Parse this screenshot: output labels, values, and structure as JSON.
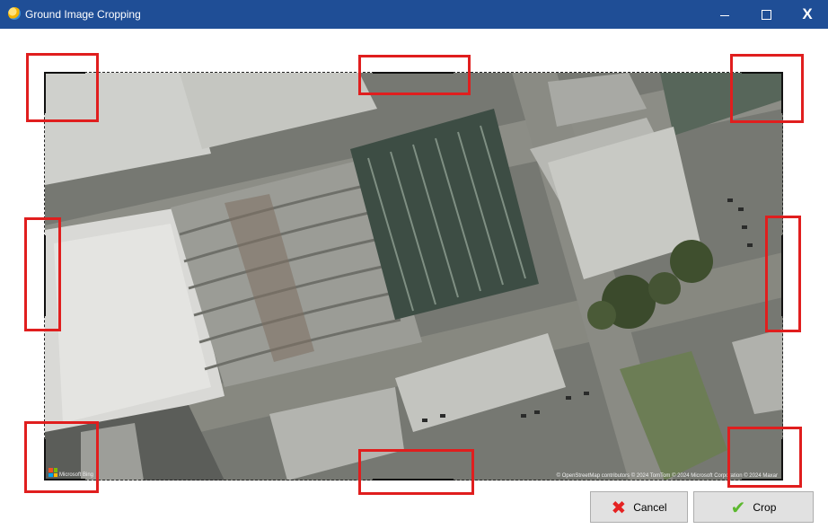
{
  "window": {
    "title": "Ground Image Cropping",
    "minimize_icon": "minimize-icon",
    "maximize_icon": "maximize-icon",
    "close_glyph": "X"
  },
  "map": {
    "attribution": "© OpenStreetMap contributors © 2024 TomTom © 2024 Microsoft Corporation © 2024 Maxar",
    "provider": "Microsoft Bing"
  },
  "buttons": {
    "cancel_label": "Cancel",
    "cancel_icon": "x-icon",
    "crop_label": "Crop",
    "crop_icon": "check-icon"
  },
  "colors": {
    "titlebar": "#1f4e96",
    "handle_border": "#e01e1e",
    "cancel_icon": "#e52222",
    "crop_icon": "#5cb82f"
  }
}
